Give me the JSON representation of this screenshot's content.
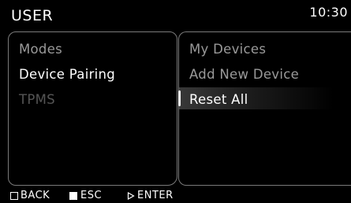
{
  "header": {
    "title": "USER",
    "clock": "10:30"
  },
  "left_menu": {
    "items": [
      {
        "label": "Modes",
        "state": "dim"
      },
      {
        "label": "Device Pairing",
        "state": "selected"
      },
      {
        "label": "TPMS",
        "state": "disabled"
      }
    ]
  },
  "right_menu": {
    "items": [
      {
        "label": "My Devices",
        "state": "dim"
      },
      {
        "label": "Add New Device",
        "state": "dim"
      },
      {
        "label": "Reset All",
        "state": "highlighted"
      }
    ]
  },
  "footer": {
    "back_label": "BACK",
    "back_icon": "outline-square-icon",
    "esc_label": "ESC",
    "esc_icon": "filled-square-icon",
    "enter_label": "ENTER",
    "enter_icon": "outline-triangle-right-icon"
  },
  "colors": {
    "background": "#000000",
    "text_active": "#ffffff",
    "text_dim": "#9a9a9a",
    "text_disabled": "#555555",
    "panel_border": "#7a7a7a"
  }
}
